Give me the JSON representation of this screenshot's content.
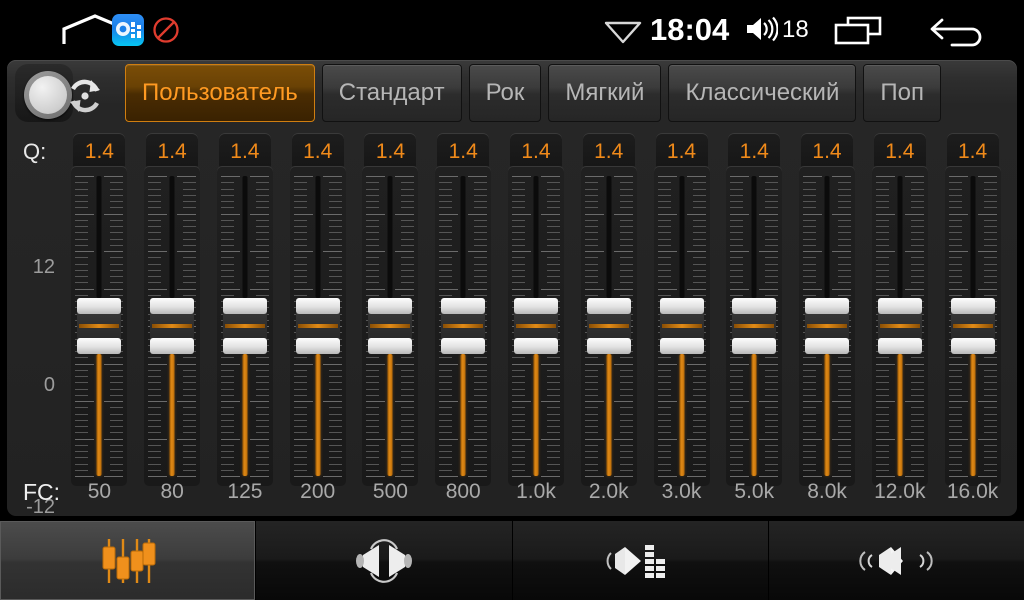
{
  "statusbar": {
    "home_icon": "home-icon",
    "app_icon": "equalizer-app-icon",
    "blocked_icon": "no-entry-icon",
    "wifi_icon": "wifi-icon",
    "clock": "18:04",
    "volume_icon": "volume-icon",
    "volume_value": "18",
    "recents_icon": "recents-icon",
    "back_icon": "back-icon"
  },
  "presets": {
    "knob_icon": "rotary-knob",
    "reset_icon": "reset-circular-arrows-icon",
    "items": [
      {
        "label": "Пользователь",
        "active": true
      },
      {
        "label": "Стандарт",
        "active": false
      },
      {
        "label": "Рок",
        "active": false
      },
      {
        "label": "Мягкий",
        "active": false
      },
      {
        "label": "Классический",
        "active": false
      },
      {
        "label": "Поп",
        "active": false
      }
    ]
  },
  "equalizer": {
    "q_label": "Q:",
    "fc_label": "FC:",
    "scale": {
      "top": "12",
      "mid": "0",
      "bottom": "-12"
    },
    "accent_color": "#f08a1a",
    "bands": [
      {
        "fc": "50",
        "q": "1.4",
        "gain_db": 0
      },
      {
        "fc": "80",
        "q": "1.4",
        "gain_db": 0
      },
      {
        "fc": "125",
        "q": "1.4",
        "gain_db": 0
      },
      {
        "fc": "200",
        "q": "1.4",
        "gain_db": 0
      },
      {
        "fc": "500",
        "q": "1.4",
        "gain_db": 0
      },
      {
        "fc": "800",
        "q": "1.4",
        "gain_db": 0
      },
      {
        "fc": "1.0k",
        "q": "1.4",
        "gain_db": 0
      },
      {
        "fc": "2.0k",
        "q": "1.4",
        "gain_db": 0
      },
      {
        "fc": "3.0k",
        "q": "1.4",
        "gain_db": 0
      },
      {
        "fc": "5.0k",
        "q": "1.4",
        "gain_db": 0
      },
      {
        "fc": "8.0k",
        "q": "1.4",
        "gain_db": 0
      },
      {
        "fc": "12.0k",
        "q": "1.4",
        "gain_db": 0
      },
      {
        "fc": "16.0k",
        "q": "1.4",
        "gain_db": 0
      }
    ]
  },
  "bottomnav": [
    {
      "icon": "equalizer-sliders-icon",
      "active": true
    },
    {
      "icon": "balance-fader-icon",
      "active": false
    },
    {
      "icon": "loudness-icon",
      "active": false
    },
    {
      "icon": "surround-icon",
      "active": false
    }
  ]
}
